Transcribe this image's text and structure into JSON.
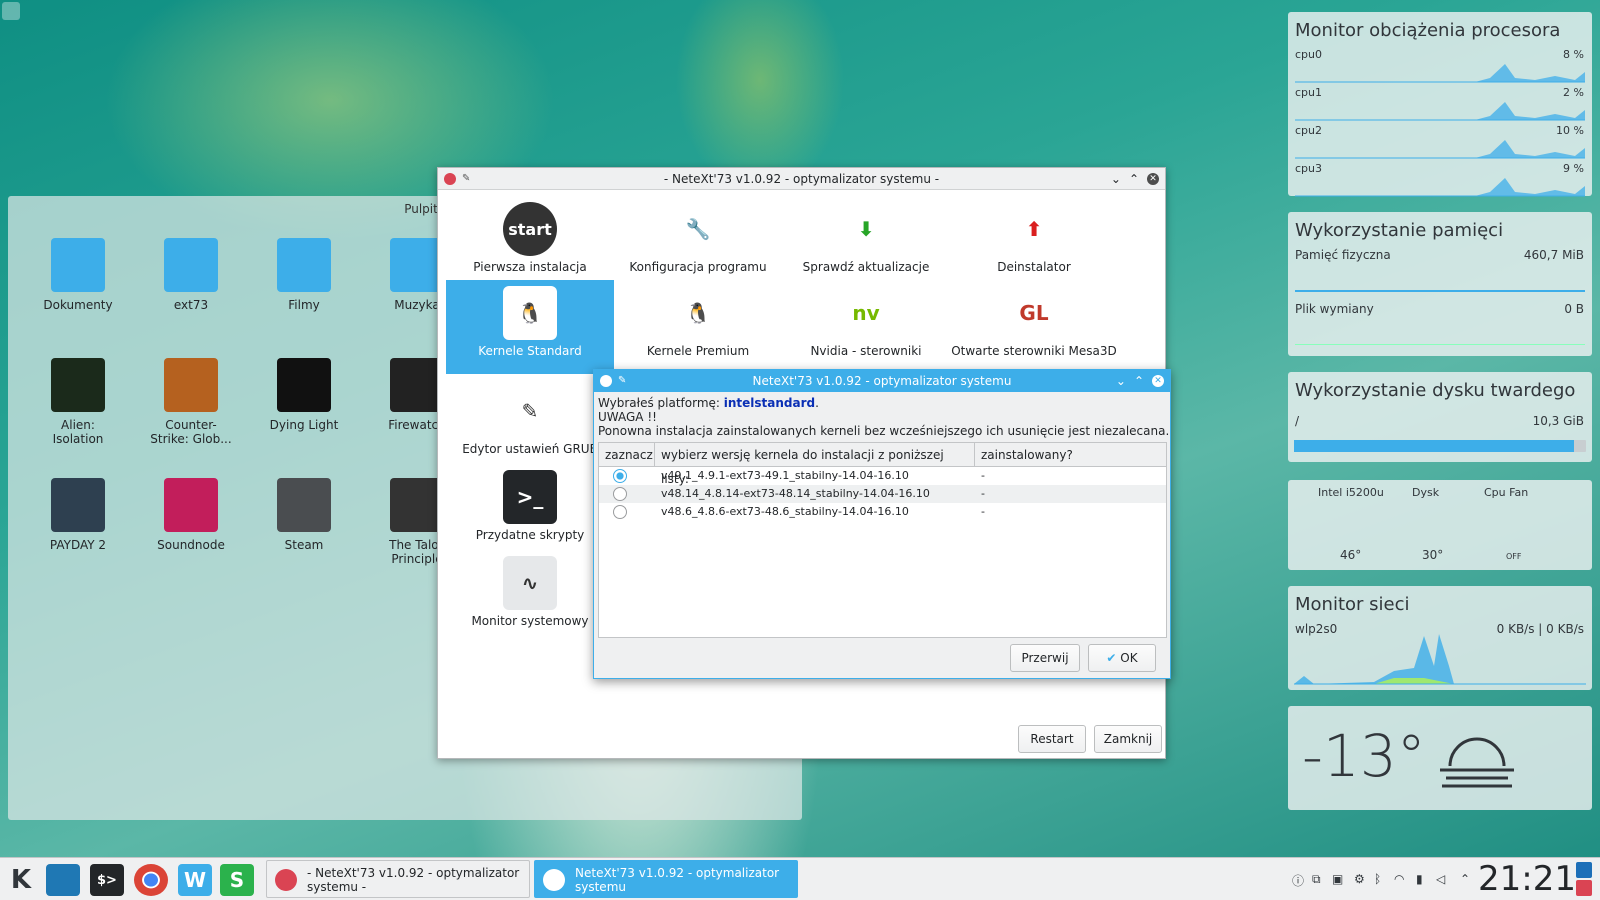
{
  "desktop": {
    "folder_title": "Pulpit",
    "icons": [
      {
        "label": "Dokumenty",
        "icon": "documents-folder-icon"
      },
      {
        "label": "ext73",
        "icon": "home-folder-icon"
      },
      {
        "label": "Filmy",
        "icon": "videos-folder-icon"
      },
      {
        "label": "Muzyka",
        "icon": "music-folder-icon"
      },
      {
        "label": "Alien:\nIsolation",
        "icon": "alien-game-icon"
      },
      {
        "label": "Counter-\nStrike: Glob...",
        "icon": "csgo-game-icon"
      },
      {
        "label": "Dying Light",
        "icon": "dying-light-game-icon"
      },
      {
        "label": "Firewatch",
        "icon": "firewatch-game-icon"
      },
      {
        "label": "PAYDAY 2",
        "icon": "payday-game-icon"
      },
      {
        "label": "Soundnode",
        "icon": "soundnode-icon"
      },
      {
        "label": "Steam",
        "icon": "steam-icon"
      },
      {
        "label": "The Talos\nPrinciple",
        "icon": "talos-game-icon"
      }
    ]
  },
  "main_window": {
    "title": "- NeteXt'73 v1.0.92 - optymalizator systemu -",
    "tiles": [
      {
        "label": "Pierwsza instalacja",
        "icon": "start-icon"
      },
      {
        "label": "Konfiguracja programu",
        "icon": "wrench-icon"
      },
      {
        "label": "Sprawdź aktualizacje",
        "icon": "download-arrow-icon"
      },
      {
        "label": "Deinstalator",
        "icon": "uninstall-arrow-icon"
      },
      {
        "label": "Kernele Standard",
        "icon": "tux-ball-icon"
      },
      {
        "label": "Kernele Premium",
        "icon": "tux-icon"
      },
      {
        "label": "Nvidia - sterowniki",
        "icon": "nvidia-icon"
      },
      {
        "label": "Otwarte sterowniki Mesa3D",
        "icon": "opengl-icon"
      },
      {
        "label": "Edytor ustawień GRUB",
        "icon": "pencil-icon"
      },
      {
        "label": "Przydatne skrypty",
        "icon": "terminal-icon"
      },
      {
        "label": "Monitor systemowy",
        "icon": "system-monitor-icon"
      }
    ],
    "restart_label": "Restart",
    "close_label": "Zamknij"
  },
  "dialog": {
    "title": "NeteXt'73 v1.0.92 - optymalizator systemu",
    "platform_prefix": "Wybrałeś platformę: ",
    "platform_value": "intelstandard",
    "platform_suffix": ".",
    "warning": "UWAGA !!",
    "warning_text": "Ponowna instalacja zainstalowanych kerneli bez wcześniejszego ich usunięcie jest niezalecana.",
    "columns": [
      "zaznacz",
      "wybierz wersję kernela do instalacji z poniższej listy:",
      "zainstalowany?"
    ],
    "rows": [
      {
        "selected": true,
        "kernel": "v49.1_4.9.1-ext73-49.1_stabilny-14.04-16.10",
        "installed": "-"
      },
      {
        "selected": false,
        "kernel": "v48.14_4.8.14-ext73-48.14_stabilny-14.04-16.10",
        "installed": "-"
      },
      {
        "selected": false,
        "kernel": "v48.6_4.8.6-ext73-48.6_stabilny-14.04-16.10",
        "installed": "-"
      }
    ],
    "cancel_label": "Przerwij",
    "ok_label": "OK"
  },
  "widgets": {
    "cpu": {
      "title": "Monitor obciążenia procesora",
      "cores": [
        {
          "name": "cpu0",
          "value": "8 %"
        },
        {
          "name": "cpu1",
          "value": "2 %"
        },
        {
          "name": "cpu2",
          "value": "10 %"
        },
        {
          "name": "cpu3",
          "value": "9 %"
        }
      ]
    },
    "memory": {
      "title": "Wykorzystanie pamięci",
      "physical_label": "Pamięć fizyczna",
      "physical_value": "460,7 MiB",
      "swap_label": "Plik wymiany",
      "swap_value": "0 B"
    },
    "disk": {
      "title": "Wykorzystanie dysku twardego",
      "mount": "/",
      "value": "10,3 GiB",
      "fill": 0.96
    },
    "sensors": {
      "labels": [
        "Intel i5200u",
        "Dysk",
        "Cpu Fan"
      ],
      "values": [
        "46°",
        "30°",
        "OFF"
      ]
    },
    "network": {
      "title": "Monitor sieci",
      "iface": "wlp2s0",
      "rate": "0 KB/s | 0 KB/s"
    },
    "weather": {
      "temp": "-13°",
      "icon": "fog-icon"
    }
  },
  "taskbar": {
    "tasks": [
      {
        "label": "- NeteXt'73 v1.0.92 - optymalizator systemu -",
        "active": false
      },
      {
        "label": "NeteXt'73 v1.0.92 - optymalizator systemu",
        "active": true
      }
    ],
    "clock": "21:21"
  },
  "colors": {
    "accent": "#3daee9",
    "panel": "#eff0f1"
  }
}
